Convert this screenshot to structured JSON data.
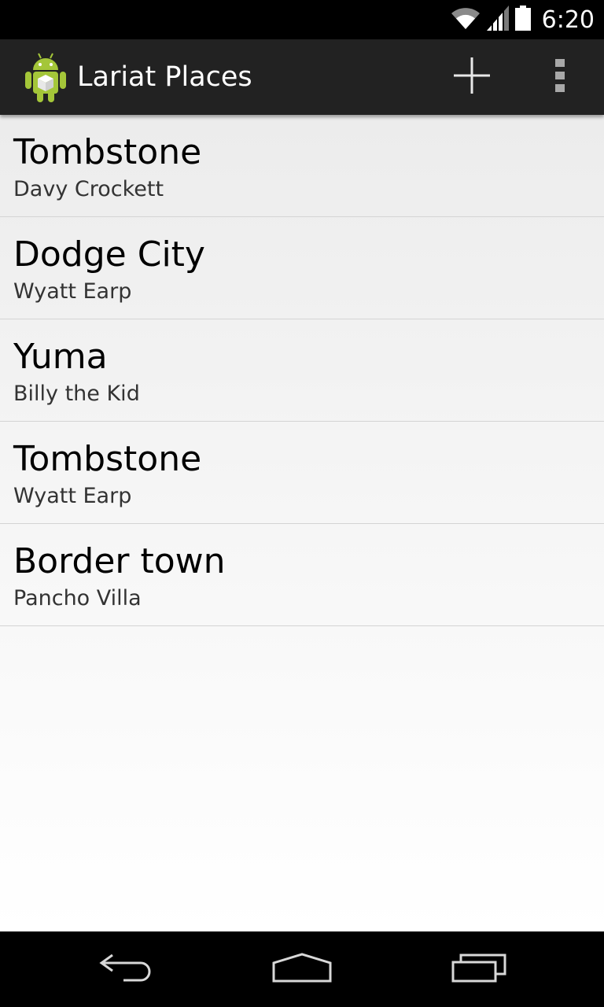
{
  "status_bar": {
    "time": "6:20",
    "icons": [
      "wifi-icon",
      "signal-icon",
      "battery-icon"
    ],
    "color": "#ffffff"
  },
  "action_bar": {
    "title": "Lariat Places",
    "app_icon": "android-robot-icon",
    "actions": [
      {
        "name": "add",
        "icon": "plus-icon"
      },
      {
        "name": "overflow",
        "icon": "more-vertical-icon"
      }
    ],
    "background": "#222222"
  },
  "places": [
    {
      "name": "Tombstone",
      "person": "Davy Crockett"
    },
    {
      "name": "Dodge City",
      "person": "Wyatt Earp"
    },
    {
      "name": "Yuma",
      "person": "Billy the Kid"
    },
    {
      "name": "Tombstone",
      "person": "Wyatt Earp"
    },
    {
      "name": "Border town",
      "person": "Pancho Villa"
    }
  ],
  "nav_bar": {
    "buttons": [
      {
        "name": "back",
        "icon": "back-icon"
      },
      {
        "name": "home",
        "icon": "home-icon"
      },
      {
        "name": "recents",
        "icon": "recent-apps-icon"
      }
    ]
  },
  "colors": {
    "android_green": "#a4c639",
    "divider": "#d4d4d4"
  }
}
